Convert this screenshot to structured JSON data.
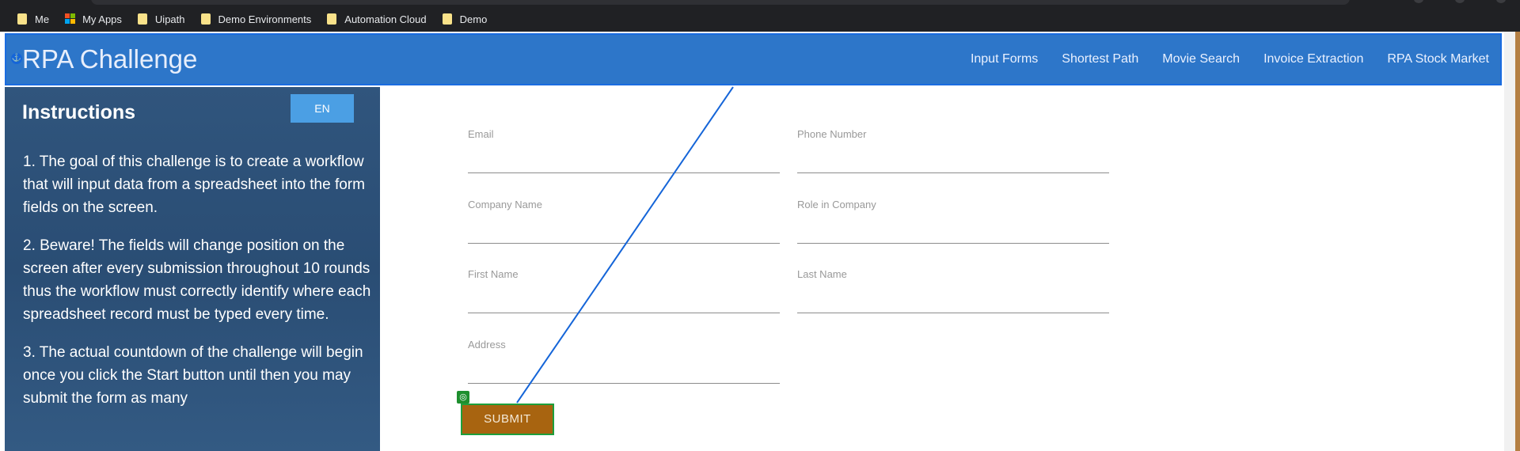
{
  "browser": {
    "bookmarks": [
      {
        "label": "Me",
        "icon": "folder-icon"
      },
      {
        "label": "My Apps",
        "icon": "microsoft-apps-icon"
      },
      {
        "label": "Uipath",
        "icon": "folder-icon"
      },
      {
        "label": "Demo Environments",
        "icon": "folder-icon"
      },
      {
        "label": "Automation Cloud",
        "icon": "folder-icon"
      },
      {
        "label": "Demo",
        "icon": "folder-icon"
      }
    ]
  },
  "navbar": {
    "brand": "RPA Challenge",
    "links": [
      "Input Forms",
      "Shortest Path",
      "Movie Search",
      "Invoice Extraction",
      "RPA Stock Market"
    ]
  },
  "sidebar": {
    "title": "Instructions",
    "lang_button": "EN",
    "paragraphs": [
      "1. The goal of this challenge is to create a workflow that will input data from a spreadsheet into the form fields on the screen.",
      "2. Beware! The fields will change position on the screen after every submission throughout 10 rounds thus the workflow must correctly identify where each spreadsheet record must be typed every time.",
      "3. The actual countdown of the challenge will begin once you click the Start button until then you may submit the form as many"
    ]
  },
  "form": {
    "fields": {
      "email": "Email",
      "phone": "Phone Number",
      "company": "Company Name",
      "role": "Role in Company",
      "first_name": "First Name",
      "last_name": "Last Name",
      "address": "Address"
    },
    "submit_label": "SUBMIT"
  },
  "colors": {
    "navbar": "#2d76c9",
    "sidebar": "#2f537b",
    "submit": "#a86410",
    "selection_outline": "#1d9f3c",
    "connector": "#1565d8"
  }
}
